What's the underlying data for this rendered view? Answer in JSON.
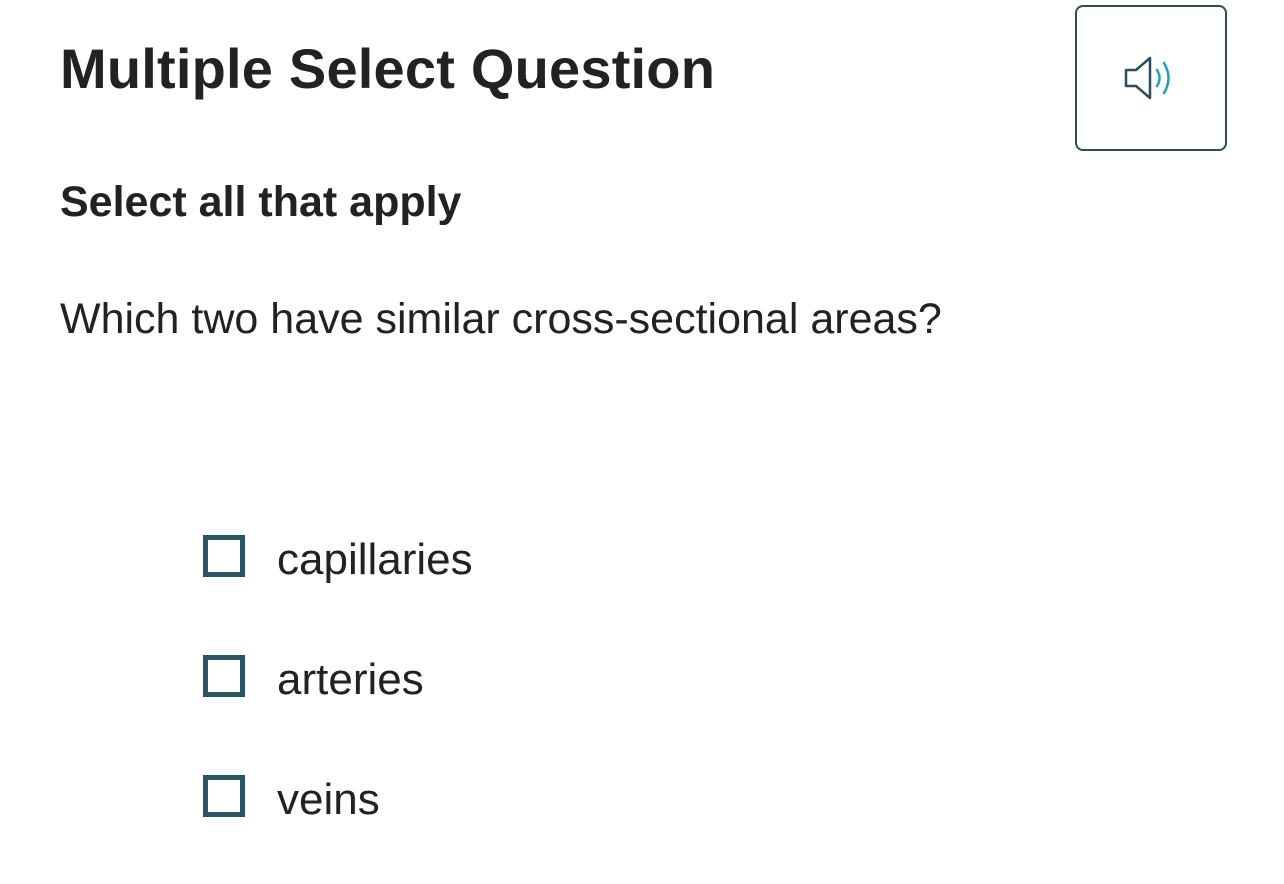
{
  "question": {
    "title": "Multiple Select Question",
    "instruction": "Select all that apply",
    "prompt": "Which two have similar cross-sectional areas?"
  },
  "audio_button": {
    "icon": "speaker-icon",
    "aria_label": "Read aloud",
    "colors": {
      "border": "#2b4e5c",
      "speaker": "#2b4e5c",
      "waves": "#1aa3c2"
    }
  },
  "options": [
    {
      "label": "capillaries",
      "checked": false
    },
    {
      "label": "arteries",
      "checked": false
    },
    {
      "label": "veins",
      "checked": false
    }
  ],
  "colors": {
    "text": "#222222",
    "checkbox_border": "#2b5563",
    "background": "#ffffff"
  }
}
